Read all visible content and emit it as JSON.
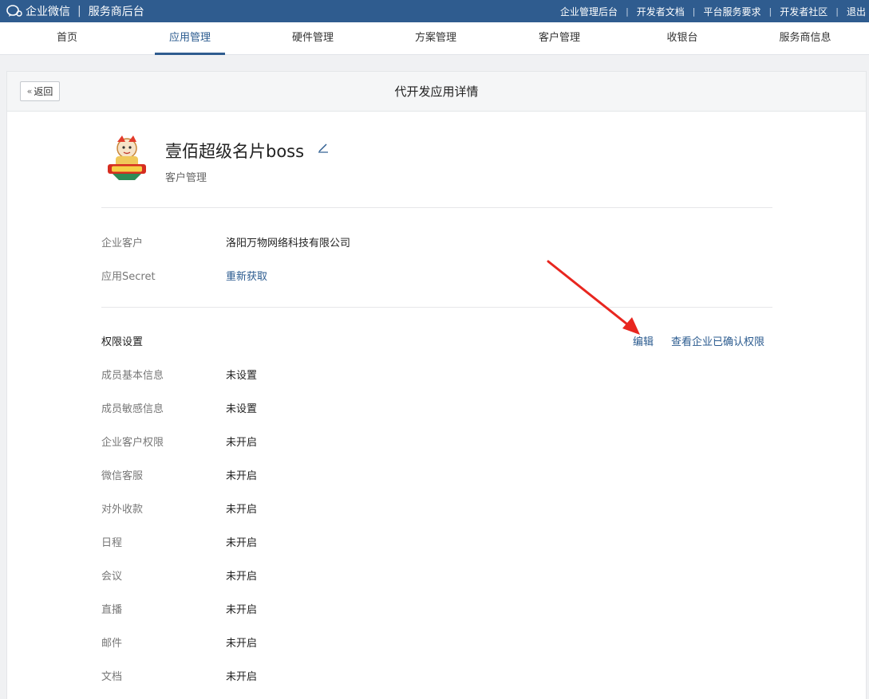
{
  "topbar": {
    "brand": "企业微信",
    "section": "服务商后台",
    "links": [
      "企业管理后台",
      "开发者文档",
      "平台服务要求",
      "开发者社区",
      "退出"
    ]
  },
  "nav": {
    "tabs": [
      "首页",
      "应用管理",
      "硬件管理",
      "方案管理",
      "客户管理",
      "收银台",
      "服务商信息"
    ],
    "active": "应用管理"
  },
  "header": {
    "back_label": "返回",
    "title": "代开发应用详情"
  },
  "app": {
    "name": "壹佰超级名片boss",
    "category": "客户管理"
  },
  "info": {
    "corp_label": "企业客户",
    "corp_value": "洛阳万物网络科技有限公司",
    "secret_label": "应用Secret",
    "secret_action": "重新获取"
  },
  "permissions": {
    "title": "权限设置",
    "edit_label": "编辑",
    "view_label": "查看企业已确认权限",
    "items": [
      {
        "label": "成员基本信息",
        "value": "未设置"
      },
      {
        "label": "成员敏感信息",
        "value": "未设置"
      },
      {
        "label": "企业客户权限",
        "value": "未开启"
      },
      {
        "label": "微信客服",
        "value": "未开启"
      },
      {
        "label": "对外收款",
        "value": "未开启"
      },
      {
        "label": "日程",
        "value": "未开启"
      },
      {
        "label": "会议",
        "value": "未开启"
      },
      {
        "label": "直播",
        "value": "未开启"
      },
      {
        "label": "邮件",
        "value": "未开启"
      },
      {
        "label": "文档",
        "value": "未开启"
      }
    ]
  },
  "colors": {
    "topbar": "#2f5c8f",
    "link": "#2b5b8f",
    "annotation_arrow": "#e8261f"
  }
}
